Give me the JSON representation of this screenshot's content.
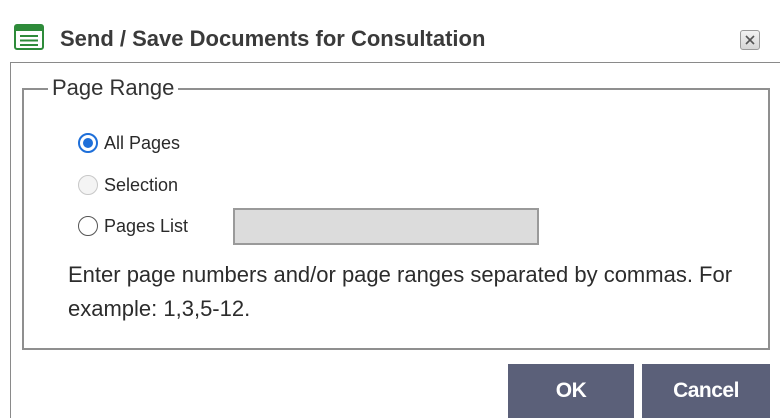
{
  "dialog": {
    "title": "Send / Save Documents for Consultation",
    "icon": "document-list-icon",
    "close_icon": "close-icon"
  },
  "page_range": {
    "legend": "Page Range",
    "options": [
      {
        "label": "All Pages",
        "state": "checked"
      },
      {
        "label": "Selection",
        "state": "disabled"
      },
      {
        "label": "Pages List",
        "state": "unchecked"
      }
    ],
    "pages_list_value": "",
    "help_text": "Enter page numbers and/or page ranges separated by commas. For example: 1,3,5-12."
  },
  "buttons": {
    "ok_label": "OK",
    "cancel_label": "Cancel"
  },
  "colors": {
    "button_bg": "#5b6079",
    "radio_accent": "#1e6fd9",
    "icon_green": "#2e8b3a"
  }
}
